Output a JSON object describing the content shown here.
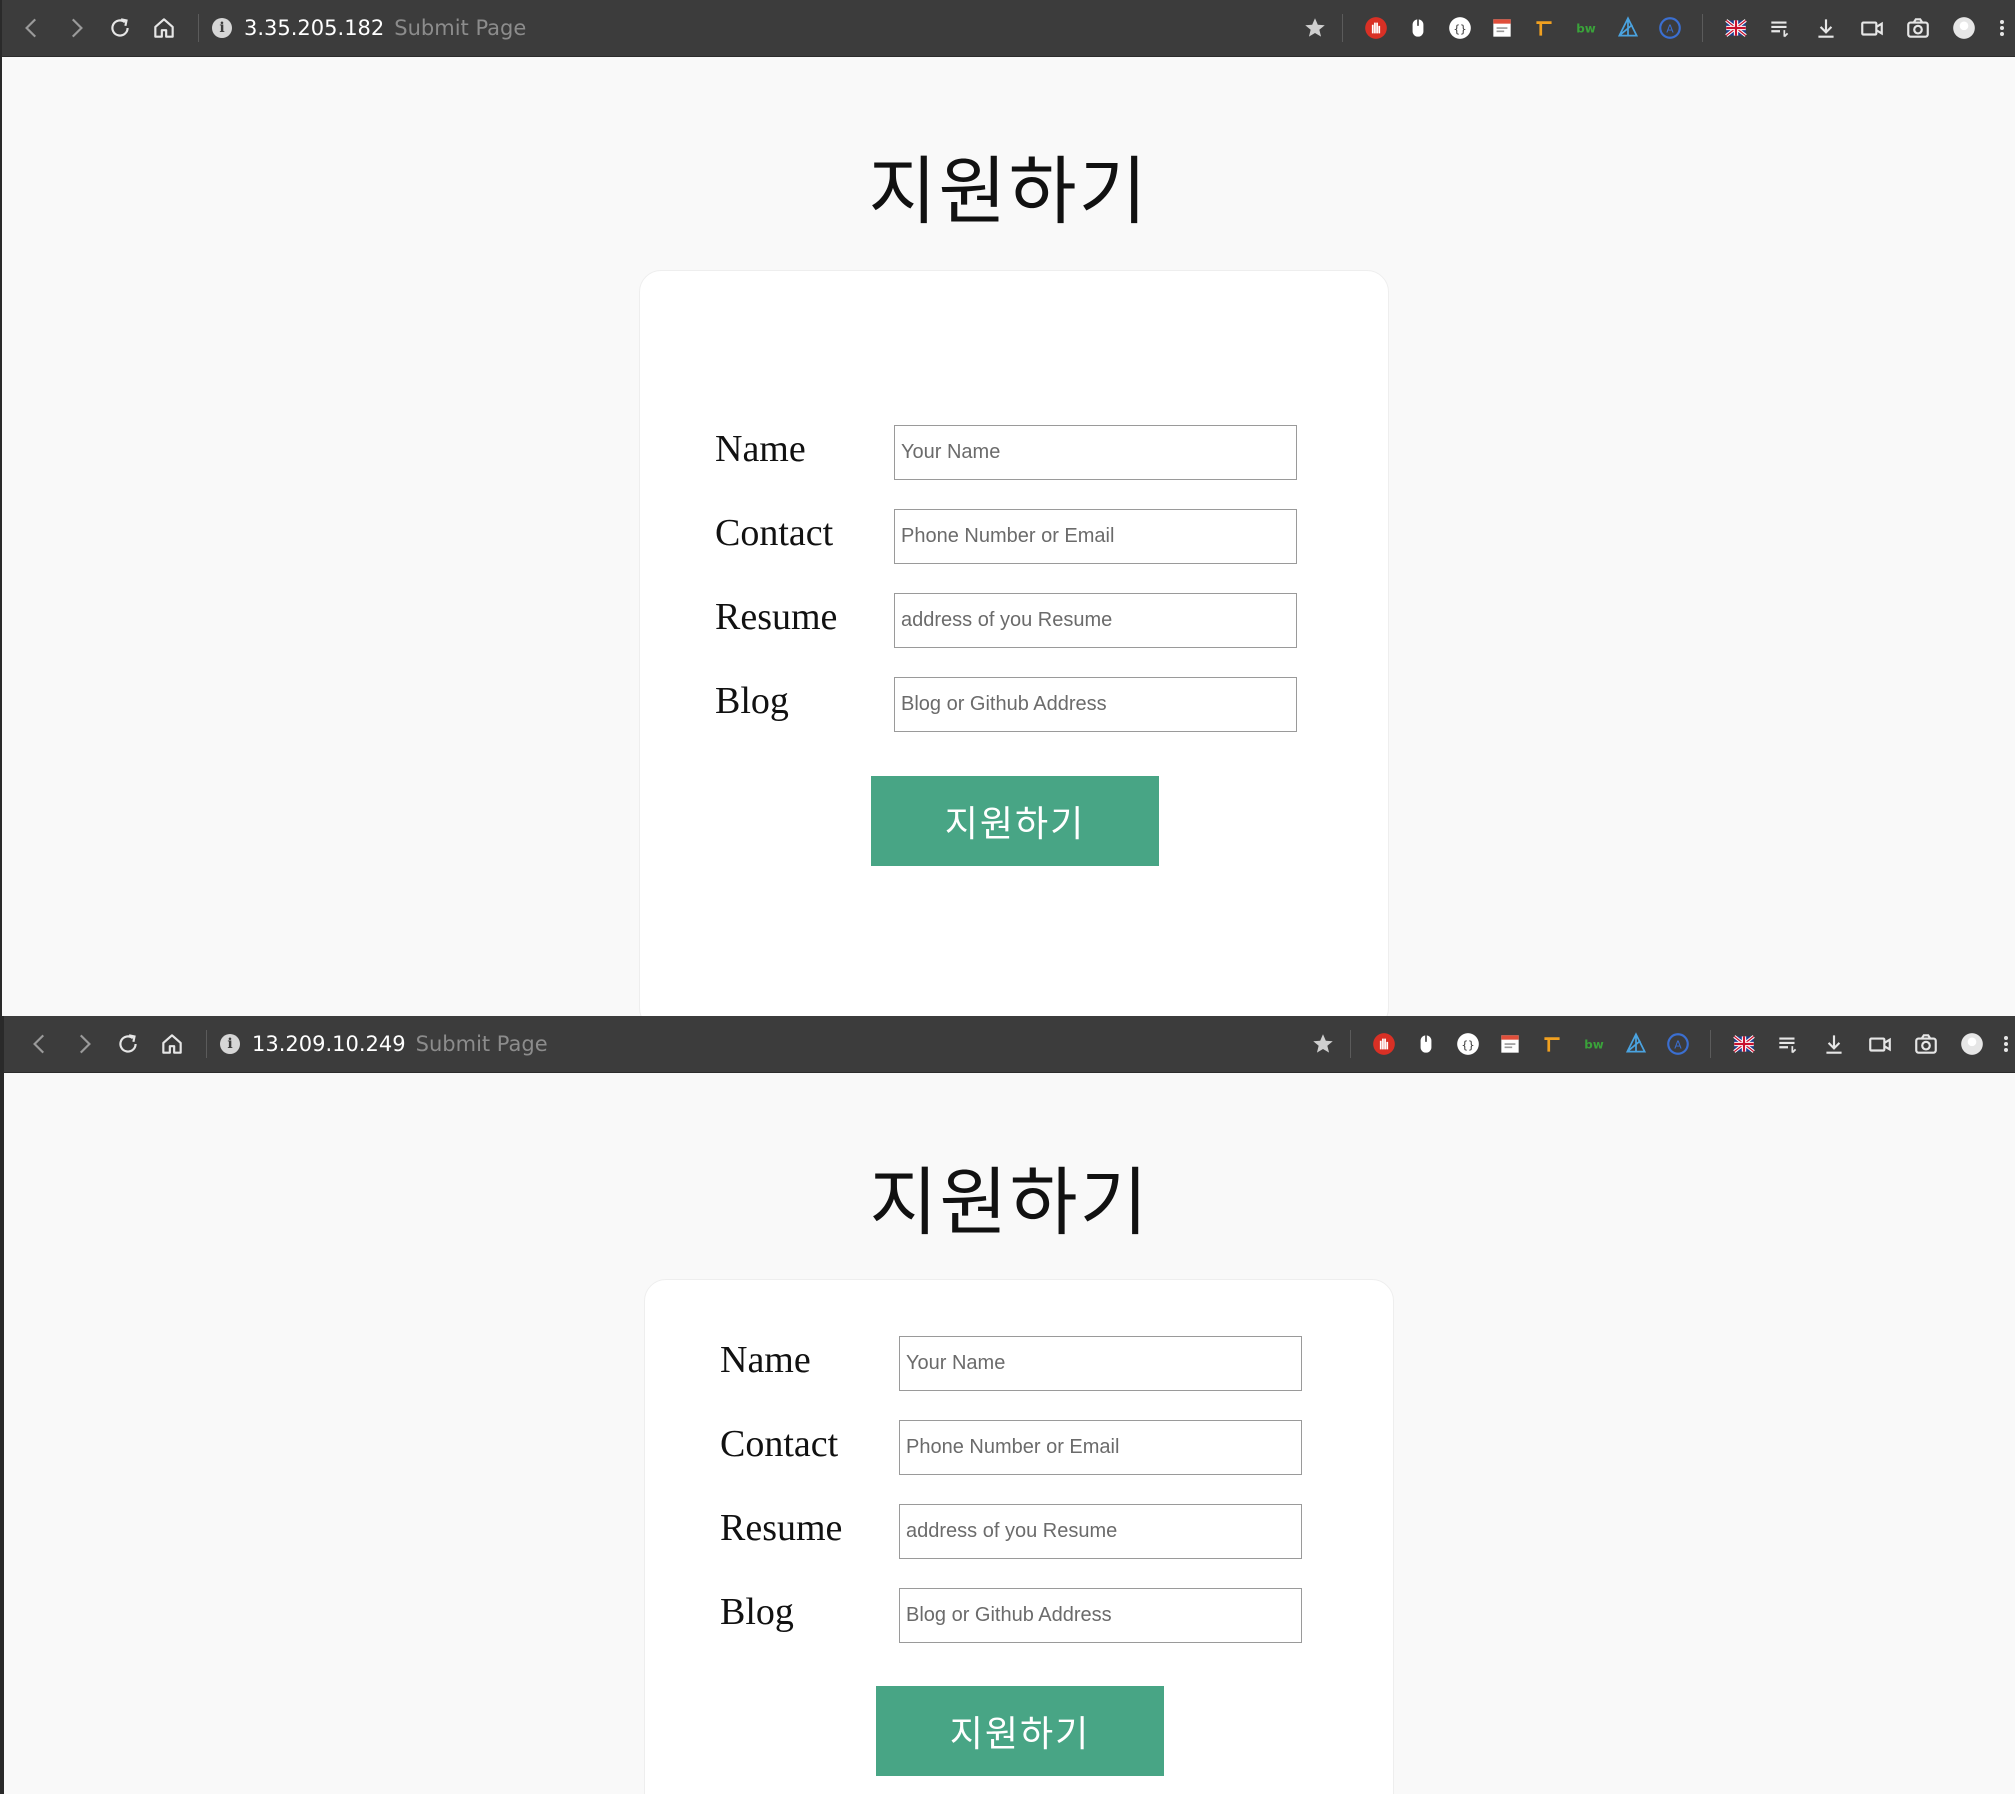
{
  "windows": [
    {
      "address": {
        "host": "3.35.205.182",
        "tab_title": "Submit Page"
      },
      "heading": "지원하기",
      "form": {
        "fields": [
          {
            "label": "Name",
            "placeholder": "Your Name"
          },
          {
            "label": "Contact",
            "placeholder": "Phone Number or Email"
          },
          {
            "label": "Resume",
            "placeholder": "address of you Resume"
          },
          {
            "label": "Blog",
            "placeholder": "Blog or Github Address"
          }
        ],
        "submit_label": "지원하기"
      }
    },
    {
      "address": {
        "host": "13.209.10.249",
        "tab_title": "Submit Page"
      },
      "heading": "지원하기",
      "form": {
        "fields": [
          {
            "label": "Name",
            "placeholder": "Your Name"
          },
          {
            "label": "Contact",
            "placeholder": "Phone Number or Email"
          },
          {
            "label": "Resume",
            "placeholder": "address of you Resume"
          },
          {
            "label": "Blog",
            "placeholder": "Blog or Github Address"
          }
        ],
        "submit_label": "지원하기"
      }
    }
  ],
  "toolbar": {
    "nav_icons": [
      "back-icon",
      "forward-icon",
      "reload-icon",
      "home-icon"
    ],
    "extension_icons": [
      "bookmark-star-icon",
      "adblock-icon",
      "mouse-gesture-icon",
      "json-viewer-icon",
      "notes-icon",
      "translate-tool-icon",
      "bw-extension-icon",
      "network-icon",
      "grammar-icon",
      "language-flag-icon",
      "playlist-icon",
      "download-icon",
      "video-icon",
      "camera-icon",
      "profile-icon",
      "more-menu-icon"
    ]
  },
  "colors": {
    "toolbar_bg": "#3c3c3c",
    "page_bg": "#f9f9f9",
    "card_bg": "#ffffff",
    "submit_bg": "#48a585",
    "adblock_red": "#d93025"
  }
}
